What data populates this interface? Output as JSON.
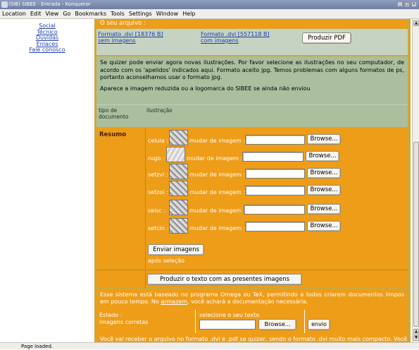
{
  "window": {
    "title": "(SIB) SIBEE - Entrada - Konqueror",
    "controls": [
      "_",
      "□",
      "×"
    ]
  },
  "menubar": [
    "Location",
    "Edit",
    "View",
    "Go",
    "Bookmarks",
    "Tools",
    "Settings",
    "Window",
    "Help"
  ],
  "leftnav": [
    "Social",
    "Técnico",
    "Duvidas",
    "Enlaces",
    "Fale conosco"
  ],
  "main": {
    "header": "O seu arquivo :",
    "formats": {
      "dvi1": "Formato .dvi [18376 B]",
      "dvi1_sub": "sem imagens",
      "dvi2": "Formato .dvi [557118 B]",
      "dvi2_sub": "com imagens",
      "pdf_button": "Produzir PDF"
    },
    "info_text": "Se quizer pode enviar agora novas ilustrações. Por favor selecione as ilustrações no seu computador, de acordo com os 'apelidos' indicados aqui. Formato aceito jpg. Temos problemas com alguns formatos de ps, portanto aconselhamos usar o formato jpg.",
    "info_text2": "Aparece a imagem reduzida ou a logomarca do SIBEE se ainda não enviou",
    "table_head": {
      "col1": "tipo de documento",
      "col2": "ilustração"
    },
    "resumo_label": "Resumo",
    "images": [
      {
        "name": "celula :",
        "change": "mudar de imagem :",
        "browse": "Browse..."
      },
      {
        "name": "rugo :",
        "change": "mudar de imagem :",
        "browse": "Browse..."
      },
      {
        "name": "setzvi :",
        "change": "mudar de imagem :",
        "browse": "Browse..."
      },
      {
        "name": "setzoi :",
        "change": "mudar de imagem :",
        "browse": "Browse..."
      },
      {
        "name": "seisc :",
        "change": "mudar de imagem :",
        "browse": "Browse..."
      },
      {
        "name": "setcin :",
        "change": "mudar de imagem :",
        "browse": "Browse..."
      }
    ],
    "enviar_button": "Enviar imagens",
    "apos_selecao": "após seleção",
    "produzir_button": "Produzir o texto com as presentes imagens",
    "footer1_a": "Esse sistema está baseado no programa Omega ou TeX, permitindo a todos criarem documentos limpos em pouco tempo. No ",
    "footer1_link": "armazem",
    "footer1_b": ", você achará a documentação necessária.",
    "estado_label": "Estado :",
    "estado_value": "imagens corretas",
    "selecione_label": "selecione o seu texto",
    "browse_text": "Browse...",
    "envio_button": "envio",
    "footer2": "Você vai receber o arquivo no formato .dvi e .pdf se quizer, sendo o formato .dvi muito mais compacto. Você"
  },
  "statusbar": "Page loaded."
}
